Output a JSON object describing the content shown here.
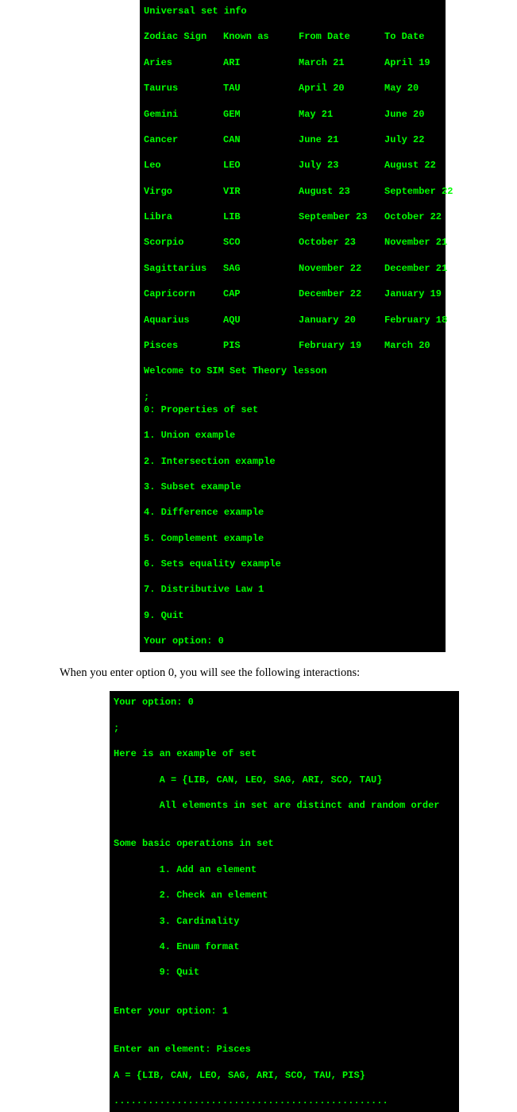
{
  "terminal1": {
    "header": "Universal set info",
    "columns": {
      "sign": "Zodiac Sign",
      "known": "Known as",
      "from": "From Date",
      "to": "To Date"
    },
    "rows": [
      {
        "sign": "Aries",
        "known": "ARI",
        "from": "March 21",
        "to": "April 19"
      },
      {
        "sign": "Taurus",
        "known": "TAU",
        "from": "April 20",
        "to": "May 20"
      },
      {
        "sign": "Gemini",
        "known": "GEM",
        "from": "May 21",
        "to": "June 20"
      },
      {
        "sign": "Cancer",
        "known": "CAN",
        "from": "June 21",
        "to": "July 22"
      },
      {
        "sign": "Leo",
        "known": "LEO",
        "from": "July 23",
        "to": "August 22"
      },
      {
        "sign": "Virgo",
        "known": "VIR",
        "from": "August 23",
        "to": "September 22"
      },
      {
        "sign": "Libra",
        "known": "LIB",
        "from": "September 23",
        "to": "October 22"
      },
      {
        "sign": "Scorpio",
        "known": "SCO",
        "from": "October 23",
        "to": "November 21"
      },
      {
        "sign": "Sagittarius",
        "known": "SAG",
        "from": "November 22",
        "to": "December 21"
      },
      {
        "sign": "Capricorn",
        "known": "CAP",
        "from": "December 22",
        "to": "January 19"
      },
      {
        "sign": "Aquarius",
        "known": "AQU",
        "from": "January 20",
        "to": "February 18"
      },
      {
        "sign": "Pisces",
        "known": "PIS",
        "from": "February 19",
        "to": "March 20"
      }
    ],
    "welcome": "Welcome to SIM Set Theory lesson",
    "menu": [
      "0: Properties of set",
      "1. Union example",
      "2. Intersection example",
      "3. Subset example",
      "4. Difference example",
      "5. Complement example",
      "6. Sets equality example",
      "7. Distributive Law 1",
      "9. Quit"
    ],
    "prompt": "Your option: 0"
  },
  "caption": "When you enter option 0, you will see the following interactions:",
  "terminal2": {
    "lines": [
      "Your option: 0",
      ";",
      "Here is an example of set",
      "        A = {LIB, CAN, LEO, SAG, ARI, SCO, TAU}",
      "        All elements in set are distinct and random order",
      "",
      "Some basic operations in set",
      "        1. Add an element",
      "        2. Check an element",
      "        3. Cardinality",
      "        4. Enum format",
      "        9: Quit",
      "",
      "Enter your option: 1",
      "",
      "Enter an element: Pisces",
      "A = {LIB, CAN, LEO, SAG, ARI, SCO, TAU, PIS}",
      "................................................"
    ]
  }
}
